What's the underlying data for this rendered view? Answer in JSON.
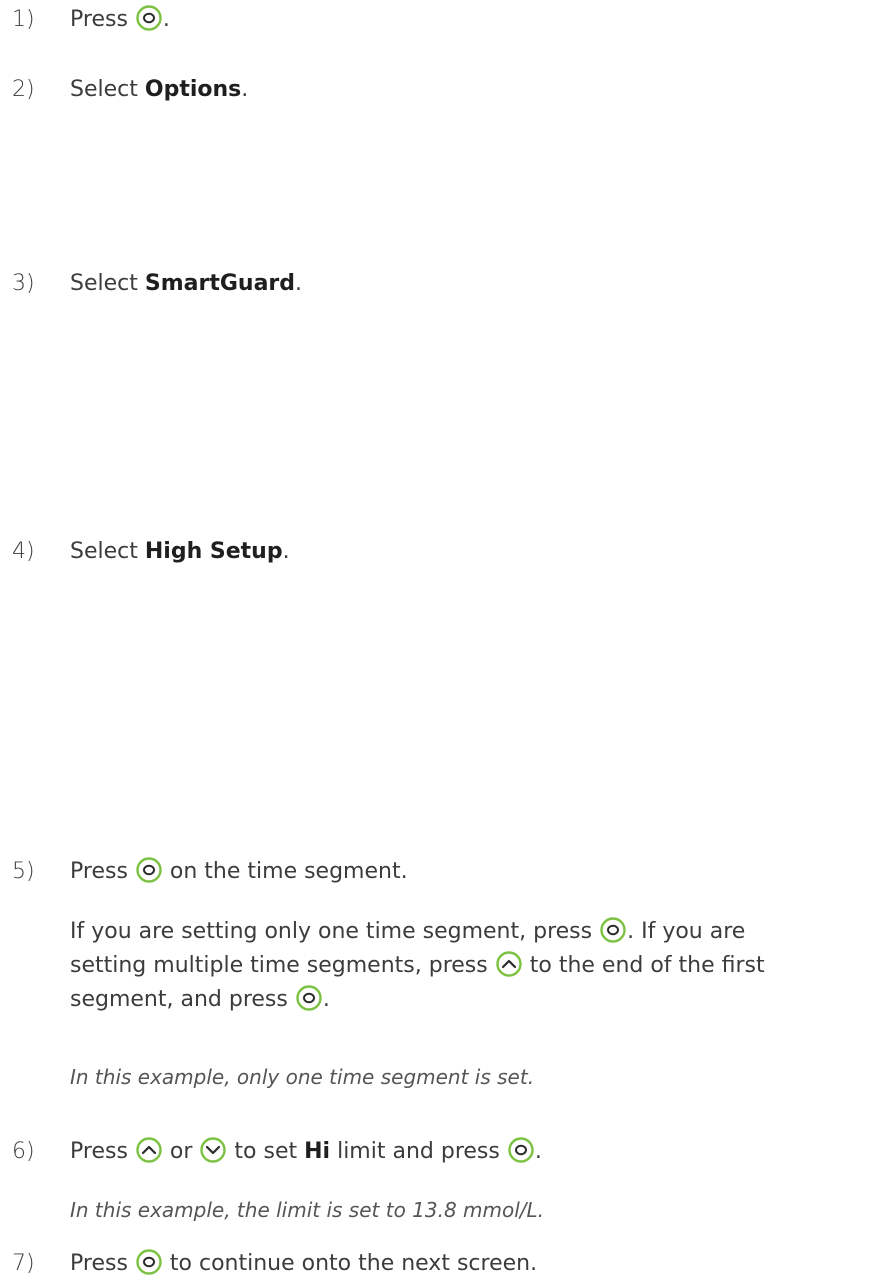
{
  "colors": {
    "button_ring": "#7cc242",
    "text": "#3c3c3c"
  },
  "steps": [
    {
      "number": "1)",
      "parts": [
        "Press",
        "."
      ]
    },
    {
      "number": "2)",
      "prefix": "Select ",
      "bold": "Options",
      "suffix": "."
    },
    {
      "number": "3)",
      "prefix": "Select ",
      "bold": "SmartGuard",
      "suffix": "."
    },
    {
      "number": "4)",
      "prefix": "Select ",
      "bold": "High Setup",
      "suffix": "."
    },
    {
      "number": "5)",
      "parts": [
        "Press",
        "on the time segment."
      ]
    },
    {
      "number": "6)",
      "parts": [
        "Press",
        "or",
        "to set",
        "Hi",
        "limit and press",
        "."
      ]
    },
    {
      "number": "7)",
      "parts": [
        "Press",
        "to continue onto the next screen."
      ]
    }
  ],
  "step5_detail": {
    "parts": [
      "If you are setting only one time segment, press",
      ". If you are",
      "setting multiple time segments, press",
      "to the end of the first",
      "segment, and press",
      "."
    ]
  },
  "notes": {
    "step5": "In this example, only one time segment is set.",
    "step6": "In this example, the limit is set to 13.8 mmol/L."
  },
  "icons": {
    "select": "select-button-icon",
    "up": "up-button-icon",
    "down": "down-button-icon"
  }
}
